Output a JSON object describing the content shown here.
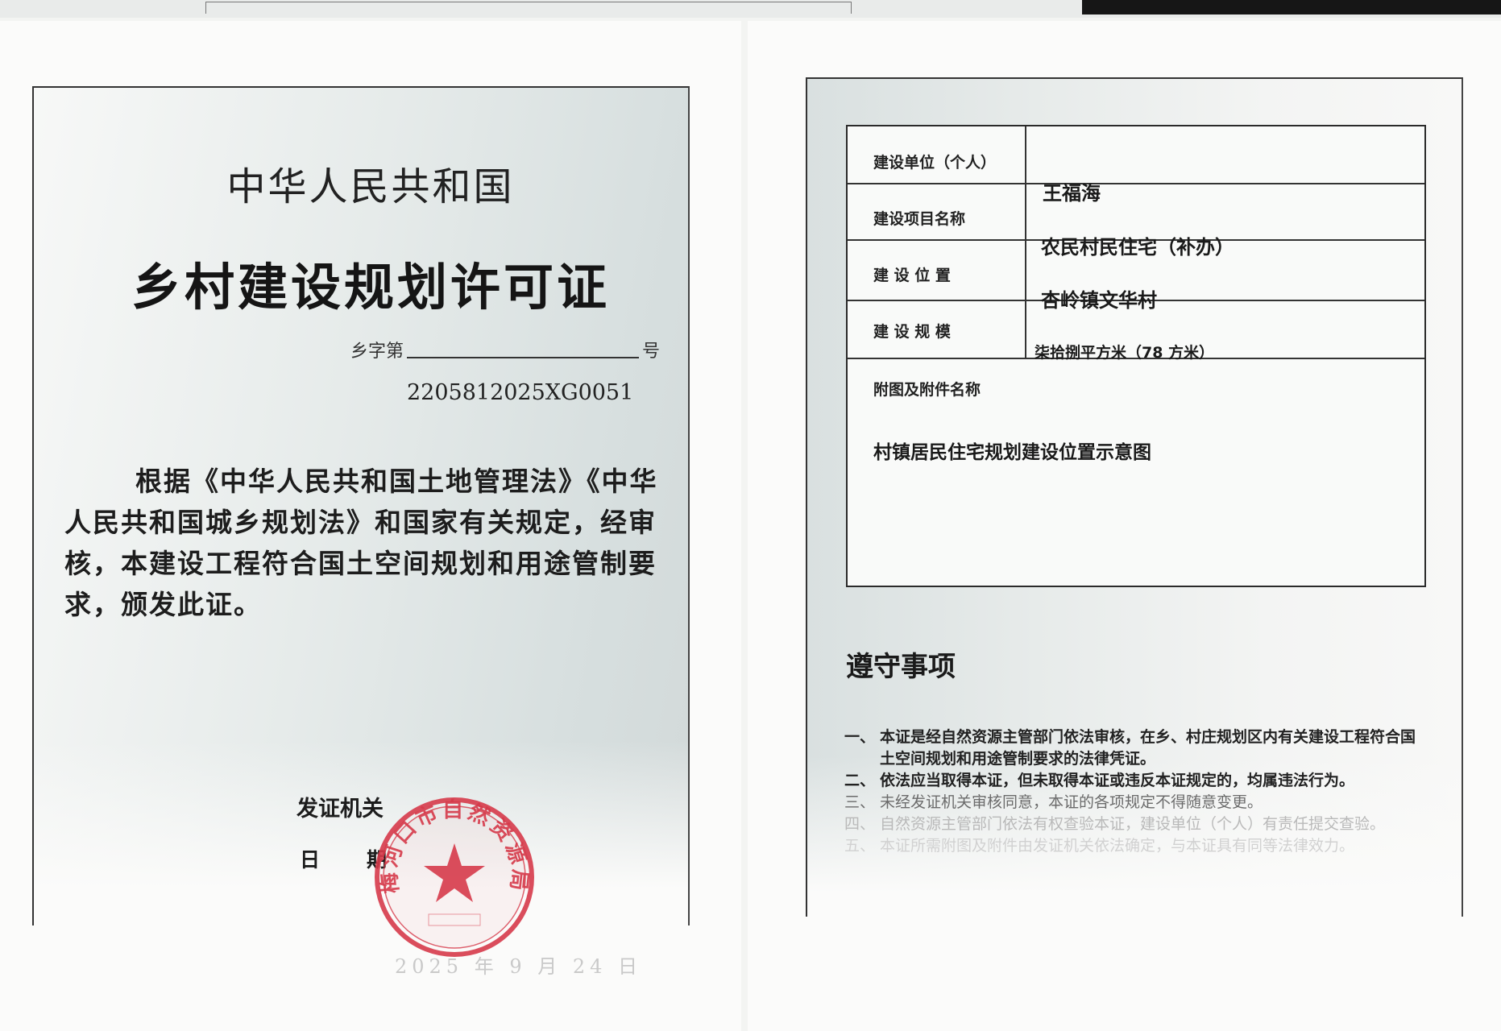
{
  "left": {
    "country": "中华人民共和国",
    "title": "乡村建设规划许可证",
    "number_prefix": "乡字第",
    "number_suffix": "号",
    "certificate_no": "2205812025XG0051",
    "body": "根据《中华人民共和国土地管理法》《中华人民共和国城乡规划法》和国家有关规定，经审核，本建设工程符合国土空间规划和用途管制要求，颁发此证。",
    "issuer_label": "发证机关",
    "date_label": "日期",
    "date_value": "2025 年 9 月 24 日",
    "seal_text": "梅河口市自然资源局"
  },
  "right": {
    "table": {
      "rows": [
        {
          "label": "建设单位（个人）",
          "value": "王福海"
        },
        {
          "label": "建设项目名称",
          "value": "农民村民住宅（补办）"
        },
        {
          "label": "建 设 位 置",
          "value": "杏岭镇文华村"
        },
        {
          "label": "建 设 规 模",
          "value": "柒拾捌平方米（78 方米）"
        }
      ],
      "attachment_label": "附图及附件名称",
      "attachment_value": "村镇居民住宅规划建设位置示意图"
    },
    "notice_title": "遵守事项",
    "notices": [
      {
        "num": "一、",
        "text": "本证是经自然资源主管部门依法审核，在乡、村庄规划区内有关建设工程符合国土空间规划和用途管制要求的法律凭证。"
      },
      {
        "num": "二、",
        "text": "依法应当取得本证，但未取得本证或违反本证规定的，均属违法行为。"
      },
      {
        "num": "三、",
        "text": "未经发证机关审核同意，本证的各项规定不得随意变更。"
      },
      {
        "num": "四、",
        "text": "自然资源主管部门依法有权查验本证，建设单位（个人）有责任提交查验。"
      },
      {
        "num": "五、",
        "text": "本证所需附图及附件由发证机关依法确定，与本证具有同等法律效力。"
      }
    ]
  }
}
